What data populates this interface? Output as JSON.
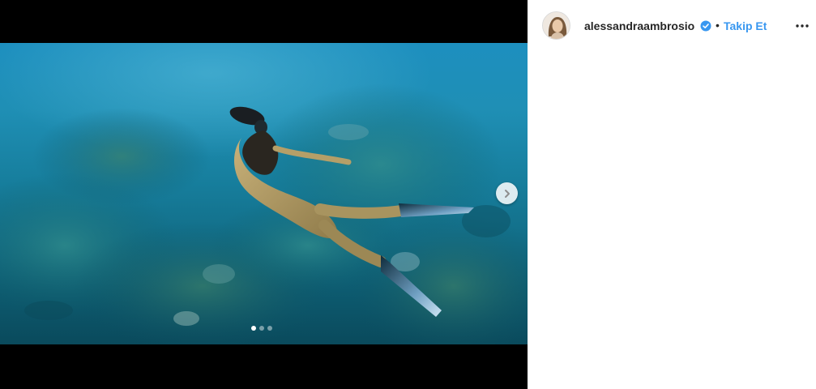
{
  "post": {
    "image_alt": "Underwater photo of a freediver with long fins swimming over a coral reef",
    "carousel": {
      "total_slides": 3,
      "active_index": 0
    },
    "next_arrow_icon": "chevron-right-icon"
  },
  "header": {
    "username": "alessandraambrosio",
    "verified_icon": "verified-badge-icon",
    "separator": "•",
    "follow_label": "Takip Et",
    "more_icon": "more-horizontal-icon"
  },
  "colors": {
    "link_blue": "#3897f0",
    "text_dark": "#262626",
    "verified_blue": "#3897f0"
  }
}
